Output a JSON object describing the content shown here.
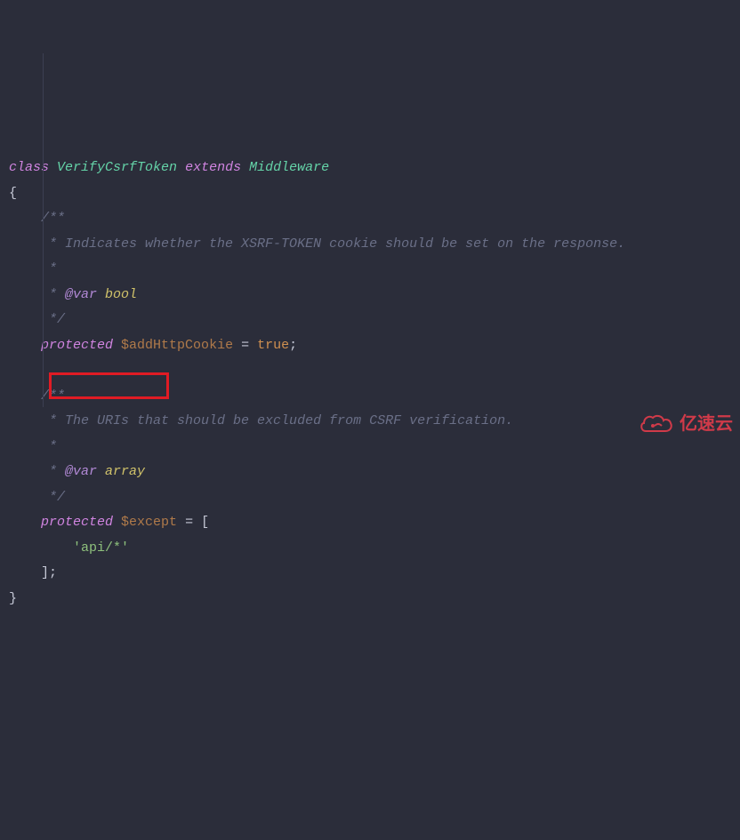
{
  "code": {
    "kw_class": "class",
    "classname": "VerifyCsrfToken",
    "kw_extends": "extends",
    "parentname": "Middleware",
    "brace_open": "{",
    "doc1_open": "/**",
    "doc1_line1": " * Indicates whether the XSRF-TOKEN cookie should be set on the response.",
    "doc1_blank": " *",
    "doc1_tag": " * ",
    "doc1_at": "@var",
    "doc1_type": " bool",
    "doc1_close": " */",
    "modifier": "protected",
    "var1": "$addHttpCookie",
    "eq": " = ",
    "true": "true",
    "semi": ";",
    "doc2_open": "/**",
    "doc2_line1": " * The URIs that should be excluded from CSRF verification.",
    "doc2_blank": " *",
    "doc2_tag": " * ",
    "doc2_at": "@var",
    "doc2_type": " array",
    "doc2_close": " */",
    "var2": "$except",
    "bracket_open": " = [",
    "string1": "'api/*'",
    "bracket_close": "];",
    "brace_close": "}"
  },
  "watermark": "亿速云"
}
